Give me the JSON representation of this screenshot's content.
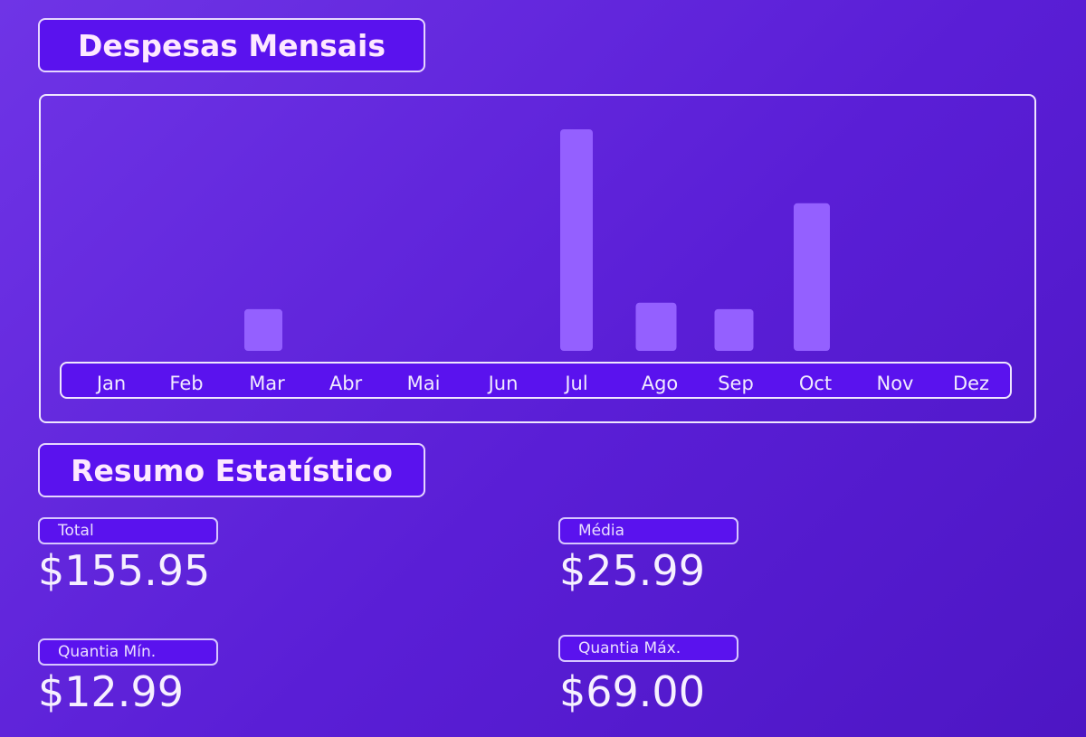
{
  "chart_title": "Despesas Mensais",
  "stats_title": "Resumo Estatístico",
  "colors": {
    "bar": "#9460ff",
    "frame": "#efe6ff",
    "label_bg": "#5a12ee"
  },
  "chart_data": {
    "type": "bar",
    "title": "Despesas Mensais",
    "categories": [
      "Jan",
      "Feb",
      "Mar",
      "Abr",
      "Mai",
      "Jun",
      "Jul",
      "Ago",
      "Sep",
      "Oct",
      "Nov",
      "Dez"
    ],
    "values": [
      0,
      0,
      12.99,
      0,
      0,
      0,
      69.0,
      15.0,
      12.99,
      45.97,
      0,
      0
    ],
    "ylim": [
      0,
      69.0
    ],
    "xlabel": "",
    "ylabel": "",
    "grid": false
  },
  "stats": {
    "total": {
      "label": "Total",
      "value": "$155.95"
    },
    "media": {
      "label": "Média",
      "value": "$25.99"
    },
    "min": {
      "label": "Quantia Mín.",
      "value": "$12.99"
    },
    "max": {
      "label": "Quantia Máx.",
      "value": "$69.00"
    }
  }
}
